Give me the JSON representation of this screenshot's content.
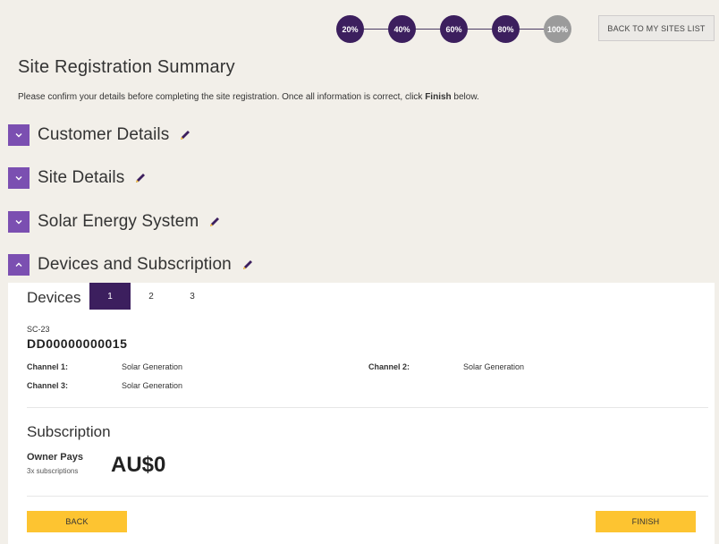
{
  "progress": {
    "steps": [
      "20%",
      "40%",
      "60%",
      "80%",
      "100%"
    ],
    "current_step": 4
  },
  "header": {
    "back_to_sites_label": "BACK TO MY SITES LIST"
  },
  "page": {
    "title": "Site Registration Summary",
    "intro_before": "Please confirm your details before completing the site registration. Once all information is correct, click ",
    "intro_bold": "Finish",
    "intro_after": " below."
  },
  "sections": [
    {
      "label": "Customer Details",
      "expanded": false
    },
    {
      "label": "Site Details",
      "expanded": false
    },
    {
      "label": "Solar Energy System",
      "expanded": false
    },
    {
      "label": "Devices and Subscription",
      "expanded": true
    }
  ],
  "devices": {
    "title": "Devices",
    "tabs": [
      "1",
      "2",
      "3"
    ],
    "active_tab": 0,
    "model": "SC-23",
    "serial": "DD00000000015",
    "channels": [
      {
        "label": "Channel 1:",
        "value": "Solar Generation"
      },
      {
        "label": "Channel 2:",
        "value": "Solar Generation"
      },
      {
        "label": "Channel 3:",
        "value": "Solar Generation"
      }
    ]
  },
  "subscription": {
    "title": "Subscription",
    "payer": "Owner Pays",
    "count": "3x subscriptions",
    "price": "AU$0"
  },
  "actions": {
    "back_label": "BACK",
    "finish_label": "FINISH"
  },
  "colors": {
    "primary_purple": "#3c1f5e",
    "toggle_purple": "#7b4fb1",
    "inactive_grey": "#9b9b9b",
    "button_yellow": "#fdc431",
    "page_bg": "#f2efe9"
  }
}
